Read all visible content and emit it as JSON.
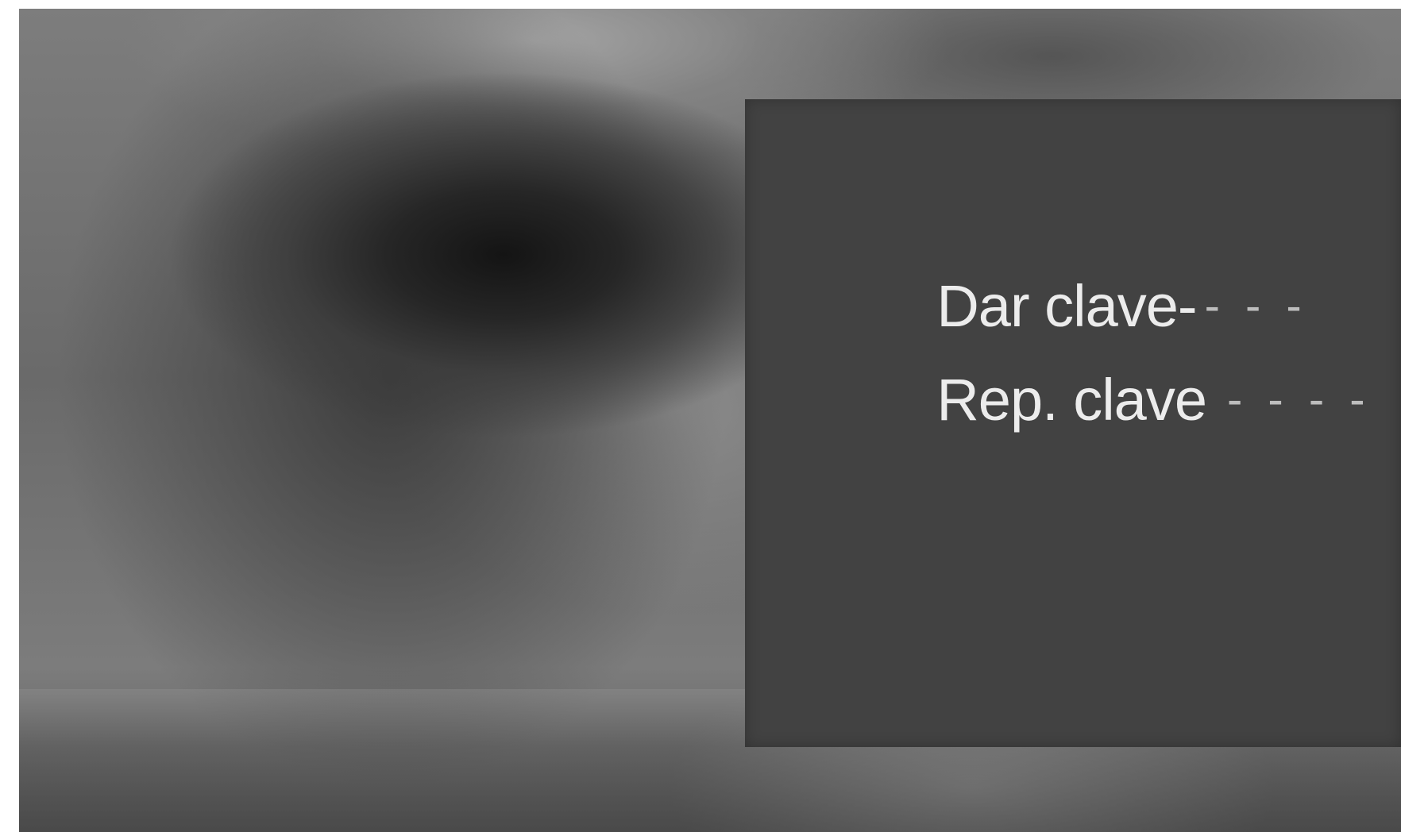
{
  "password_menu": {
    "enter_code": {
      "label": "Dar clave-",
      "value": "- - -"
    },
    "repeat_code": {
      "label": "Rep. clave",
      "value": "- - - -"
    }
  },
  "colors": {
    "panel_background": "#424242",
    "label_text": "#ececec",
    "placeholder_dashes": "#bdbdbd"
  }
}
